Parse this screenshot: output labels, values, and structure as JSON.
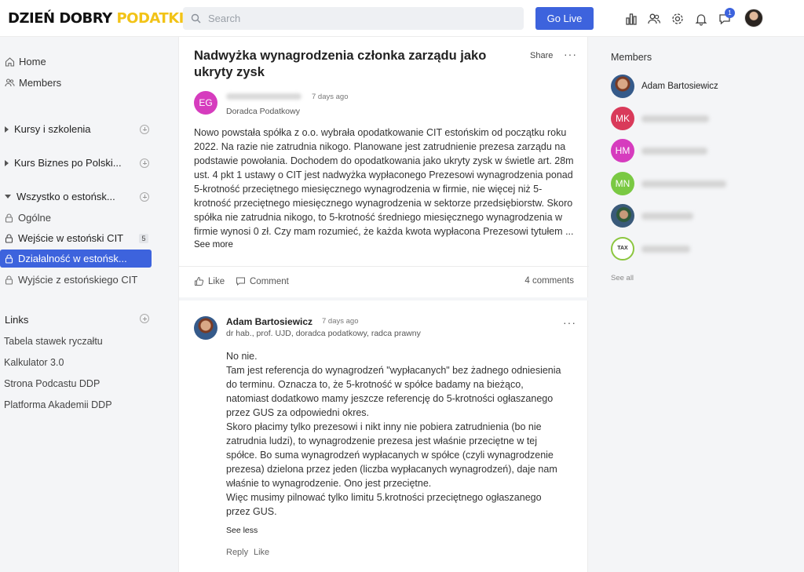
{
  "header": {
    "logo_part1": "DZIEŃ DOBRY",
    "logo_part2": "PODATKI",
    "search_placeholder": "Search",
    "golive_label": "Go Live",
    "notification_badge": "1",
    "icons": [
      "chart-icon",
      "members-icon",
      "settings-icon",
      "bell-icon",
      "chat-icon"
    ]
  },
  "sidebar": {
    "nav": [
      {
        "label": "Home",
        "icon": "home-icon"
      },
      {
        "label": "Members",
        "icon": "members-icon"
      }
    ],
    "groups": [
      {
        "label": "Kursy i szkolenia",
        "expanded": false
      },
      {
        "label": "Kurs Biznes po Polski...",
        "expanded": false
      },
      {
        "label": "Wszystko o estońsk...",
        "expanded": true
      }
    ],
    "channels": [
      {
        "label": "Ogólne",
        "bold": false,
        "active": false
      },
      {
        "label": "Wejście w estoński CIT",
        "bold": true,
        "active": false,
        "count": "5"
      },
      {
        "label": "Działalność w estońsk...",
        "bold": false,
        "active": true
      },
      {
        "label": "Wyjście z estońskiego CIT",
        "bold": false,
        "active": false
      }
    ],
    "links_title": "Links",
    "links": [
      "Tabela stawek ryczałtu",
      "Kalkulator 3.0",
      "Strona Podcastu DDP",
      "Platforma Akademii DDP"
    ]
  },
  "post": {
    "title": "Nadwyżka wynagrodzenia członka zarządu jako ukryty zysk",
    "share_label": "Share",
    "author_initials": "EG",
    "author_color": "#d63cbe",
    "time": "7 days ago",
    "author_role": "Doradca Podatkowy",
    "body": "Nowo powstała spółka z o.o. wybrała opodatkowanie CIT estońskim od początku roku 2022. Na razie nie zatrudnia nikogo. Planowane jest zatrudnienie prezesa zarządu na podstawie powołania. Dochodem do opodatkowania jako ukryty zysk w świetle art. 28m ust. 4 pkt 1 ustawy o CIT jest nadwyżka wypłaconego Prezesowi wynagrodzenia ponad 5-krotność przeciętnego miesięcznego wynagrodzenia w firmie, nie więcej niż 5-krotność przeciętnego miesięcznego wynagrodzenia w sektorze przedsiębiorstw. Skoro spółka nie zatrudnia nikogo, to 5-krotność średniego miesięcznego wynagrodzenia w firmie wynosi 0 zł. Czy mam  rozumieć, że każda kwota wypłacona Prezesowi tytułem ...",
    "see_more": "See more",
    "like_label": "Like",
    "comment_label": "Comment",
    "comments_count": "4 comments"
  },
  "comment": {
    "author": "Adam Bartosiewicz",
    "time": "7 days ago",
    "role": "dr hab., prof. UJD, doradca podatkowy, radca prawny",
    "lines": [
      "No nie.",
      "Tam jest referencja do wynagrodzeń \"wypłacanych\" bez żadnego odniesienia do terminu. Oznacza to, że 5-krotność w spółce badamy na bieżąco, natomiast dodatkowo mamy jeszcze referencję do 5-krotności ogłaszanego przez GUS za odpowiedni okres.",
      "Skoro płacimy tylko prezesowi i nikt inny nie pobiera zatrudnienia (bo nie zatrudnia ludzi), to wynagrodzenie prezesa jest właśnie przeciętne w tej spółce. Bo suma wynagrodzeń wypłacanych w spółce (czyli wynagrodzenie prezesa) dzielona przez jeden (liczba wypłacanych wynagrodzeń), daje nam właśnie to wynagrodzenie. Ono jest przeciętne.",
      "Więc musimy pilnować tylko limitu 5.krotności przeciętnego ogłaszanego przez GUS."
    ],
    "see_less": "See less",
    "reply_label": "Reply",
    "like_label": "Like"
  },
  "members": {
    "title": "Members",
    "list": [
      {
        "name": "Adam Bartosiewicz",
        "initials": "",
        "color": "#8b5a3c",
        "photo": true
      },
      {
        "name": "",
        "initials": "MK",
        "color": "#d93a5a",
        "photo": false
      },
      {
        "name": "",
        "initials": "HM",
        "color": "#d63cbe",
        "photo": false
      },
      {
        "name": "",
        "initials": "MN",
        "color": "#7ac943",
        "photo": false
      },
      {
        "name": "",
        "initials": "",
        "color": "#3a5a7a",
        "photo": true
      },
      {
        "name": "",
        "initials": "TAX",
        "color": "#ffffff",
        "photo": false
      }
    ],
    "see_all": "See all"
  }
}
